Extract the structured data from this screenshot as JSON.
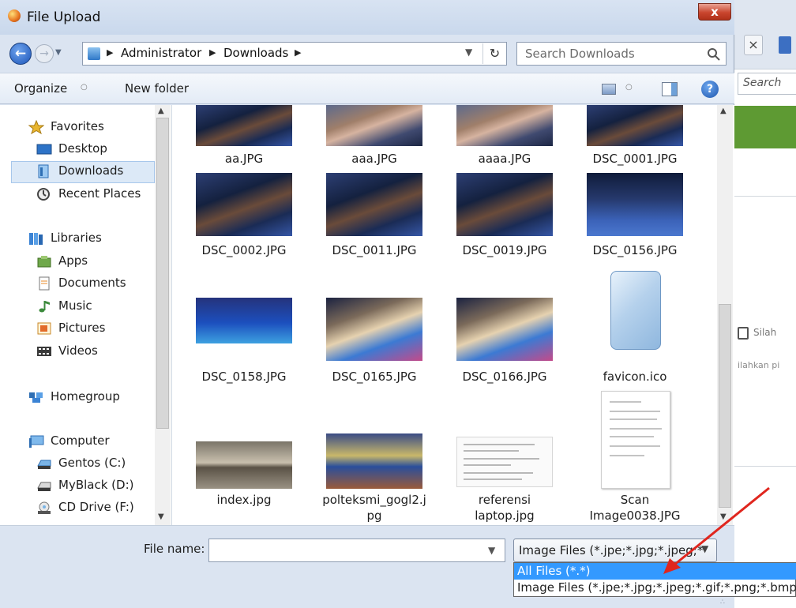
{
  "window": {
    "title": "File Upload",
    "close_label": "x"
  },
  "address": {
    "crumbs": [
      "Administrator",
      "Downloads"
    ],
    "search_placeholder": "Search Downloads"
  },
  "toolbar": {
    "organize": "Organize",
    "new_folder": "New folder"
  },
  "nav": {
    "favorites": "Favorites",
    "desktop": "Desktop",
    "downloads": "Downloads",
    "recent": "Recent Places",
    "libraries": "Libraries",
    "apps": "Apps",
    "documents": "Documents",
    "music": "Music",
    "pictures": "Pictures",
    "videos": "Videos",
    "homegroup": "Homegroup",
    "computer": "Computer",
    "drive_c": "Gentos (C:)",
    "drive_d": "MyBlack (D:)",
    "drive_f": "CD Drive (F:)"
  },
  "files": [
    {
      "name": "aa.JPG",
      "kind": "photo"
    },
    {
      "name": "aaa.JPG",
      "kind": "photo"
    },
    {
      "name": "aaaa.JPG",
      "kind": "photo"
    },
    {
      "name": "DSC_0001.JPG",
      "kind": "photo"
    },
    {
      "name": "DSC_0002.JPG",
      "kind": "photo"
    },
    {
      "name": "DSC_0011.JPG",
      "kind": "photo"
    },
    {
      "name": "DSC_0019.JPG",
      "kind": "photo"
    },
    {
      "name": "DSC_0156.JPG",
      "kind": "photo"
    },
    {
      "name": "DSC_0158.JPG",
      "kind": "photo"
    },
    {
      "name": "DSC_0165.JPG",
      "kind": "photo"
    },
    {
      "name": "DSC_0166.JPG",
      "kind": "photo"
    },
    {
      "name": "favicon.ico",
      "kind": "icon"
    },
    {
      "name": "index.jpg",
      "kind": "photo"
    },
    {
      "name": "polteksmi_gogl2.j\npg",
      "kind": "photo"
    },
    {
      "name": "referensi\nlaptop.jpg",
      "kind": "document"
    },
    {
      "name": "Scan\nImage0038.JPG",
      "kind": "scan"
    }
  ],
  "bottom": {
    "file_name_label": "File name:",
    "file_name_value": "",
    "file_type_selected": "Image Files (*.jpe;*.jpg;*.jpeg;*",
    "options": [
      "All Files (*.*)",
      "Image Files (*.jpe;*.jpg;*.jpeg;*.gif;*.png;*.bmp;*"
    ]
  },
  "background": {
    "search_text": "Search",
    "text1": "Silah",
    "text2": "ilahkan pi",
    "close_tab": "×"
  },
  "colors": {
    "selection": "#3399ff",
    "arrow": "#e0261e",
    "nav_highlight": "#dce9f7"
  }
}
